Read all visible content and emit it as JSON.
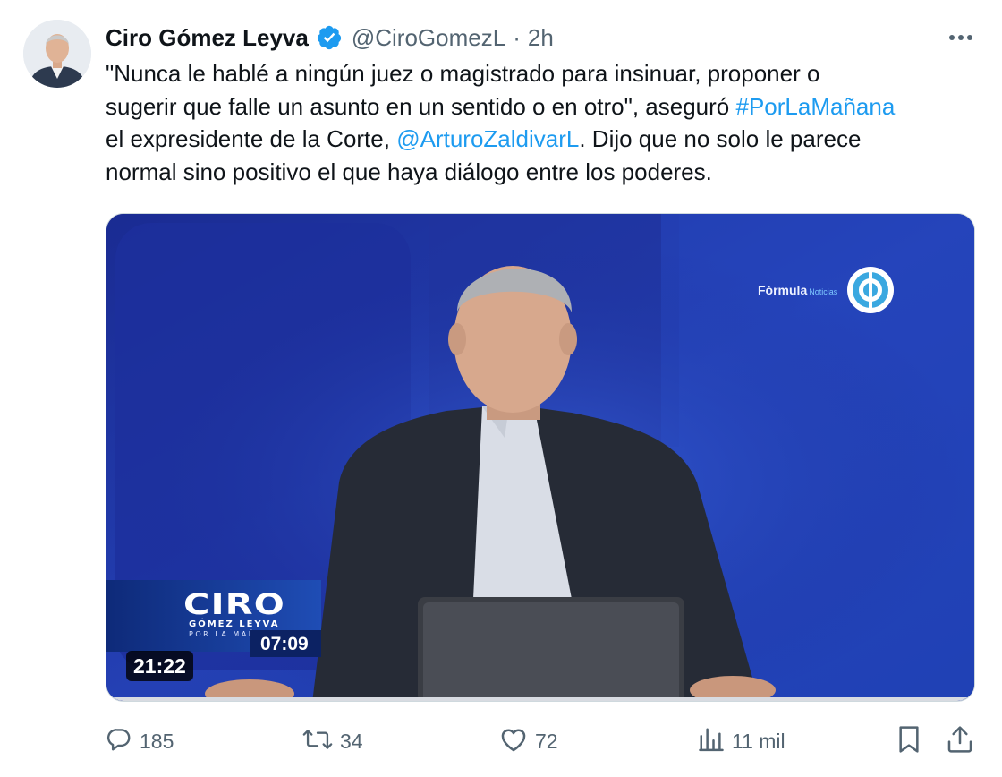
{
  "tweet": {
    "author": {
      "name": "Ciro Gómez Leyva",
      "handle": "@CiroGomezL",
      "separator": "·",
      "time": "2h"
    },
    "text": {
      "line1": "\"Nunca le hablé a ningún juez o magistrado para insinuar, proponer o",
      "line2_a": "sugerir que falle un asunto en un sentido o en otro\", aseguró ",
      "line2_hashtag": "#PorLaMañana",
      "line3_a": "el expresidente de la Corte, ",
      "line3_mention": "@ArturoZaldivarL",
      "line3_b": ". Dijo que no solo le parece",
      "line4": "normal sino positivo el que haya diálogo entre los poderes."
    },
    "media": {
      "duration": "21:22",
      "overlay_title": "CIRO",
      "overlay_sub1": "GÓMEZ LEYVA",
      "overlay_sub2": "POR LA MAÑANA",
      "overlay_clock": "07:09",
      "brand": "Fórmula",
      "brand_sub": "Noticias"
    },
    "actions": {
      "replies": "185",
      "retweets": "34",
      "likes": "72",
      "views": "11 mil"
    },
    "colors": {
      "link": "#1d9bf0",
      "muted": "#536471",
      "verified": "#1d9bf0"
    },
    "icons": [
      "verified-badge-icon",
      "more-icon",
      "reply-icon",
      "retweet-icon",
      "like-icon",
      "views-icon",
      "bookmark-icon",
      "share-icon"
    ]
  }
}
